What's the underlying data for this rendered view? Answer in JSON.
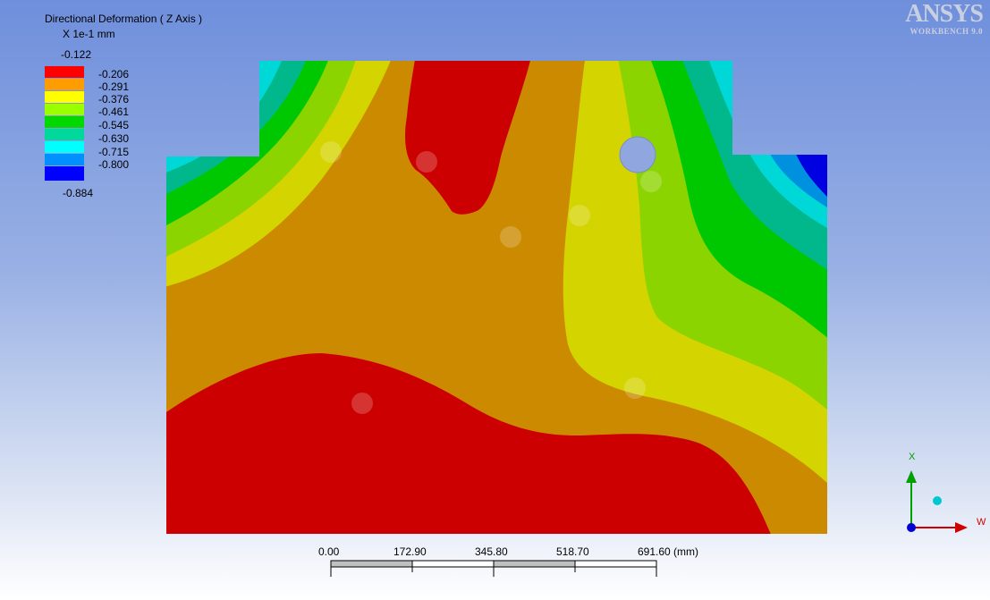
{
  "result": {
    "title": "Directional Deformation ( Z Axis )",
    "units": "X 1e-1 mm"
  },
  "legend": {
    "max": "-0.122",
    "min": "-0.884",
    "levels": [
      "-0.206",
      "-0.291",
      "-0.376",
      "-0.461",
      "-0.545",
      "-0.630",
      "-0.715",
      "-0.800"
    ],
    "colors": [
      "#ff0000",
      "#ff9c00",
      "#ffff00",
      "#9cff00",
      "#00d800",
      "#00d89c",
      "#00ffff",
      "#0090ff",
      "#0000ff"
    ]
  },
  "contour_colors": {
    "red": "#cc0000",
    "orange": "#cc8a00",
    "yellow": "#d4d400",
    "lightgreen": "#8cd400",
    "green": "#00c800",
    "teal": "#00b88c",
    "cyan": "#00d8d8",
    "lightblue": "#0090e0",
    "blue": "#0000e0"
  },
  "logo": {
    "name": "ANSYS",
    "product": "WORKBENCH 9.0"
  },
  "scale": {
    "labels": [
      "0.00",
      "172.90",
      "345.80",
      "518.70",
      "691.60 (mm)"
    ]
  },
  "triad": {
    "x_label": "X",
    "w_label": "W"
  }
}
